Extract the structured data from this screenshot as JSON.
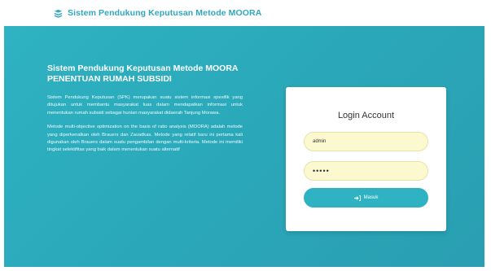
{
  "header": {
    "brand_title": "Sistem Pendukung Keputusan Metode MOORA",
    "brand_icon": "layers-icon"
  },
  "intro": {
    "headline_line1": "Sistem Pendukung Keputusan Metode MOORA",
    "headline_line2": "PENENTUAN RUMAH SUBSIDI",
    "paragraph1": "Sistem Pendukung Keputusan (SPK) merupakan suatu sistem informasi spesifik yang ditujukan untuk membantu masyarakat luas dalam mendapatkan informasi untuk menentukan rumah subsidi sebagai hunian masyarakat didaerah Tanjung Morawa.",
    "paragraph2": "Metode multi-objective optimization on the basis of ratio analysis (MOORA) adalah metode yang diperkenalkan oleh Brauers dan Zavadkas. Metode yang relatif baru ini pertama kali digunakan oleh Brauers dalam suatu pengambilan dengan multi-kriteria. Metode ini memiliki tingkat selektifitas yang baik dalam menentukan suatu alternatif"
  },
  "login": {
    "title": "Login Account",
    "username_value": "admin",
    "password_value": "•••••",
    "submit_label": "Masuk",
    "submit_icon": "sign-in-icon"
  },
  "colors": {
    "accent": "#2fb2c2",
    "brand_text": "#2fa8bf",
    "input_bg": "#fcf8cf"
  }
}
